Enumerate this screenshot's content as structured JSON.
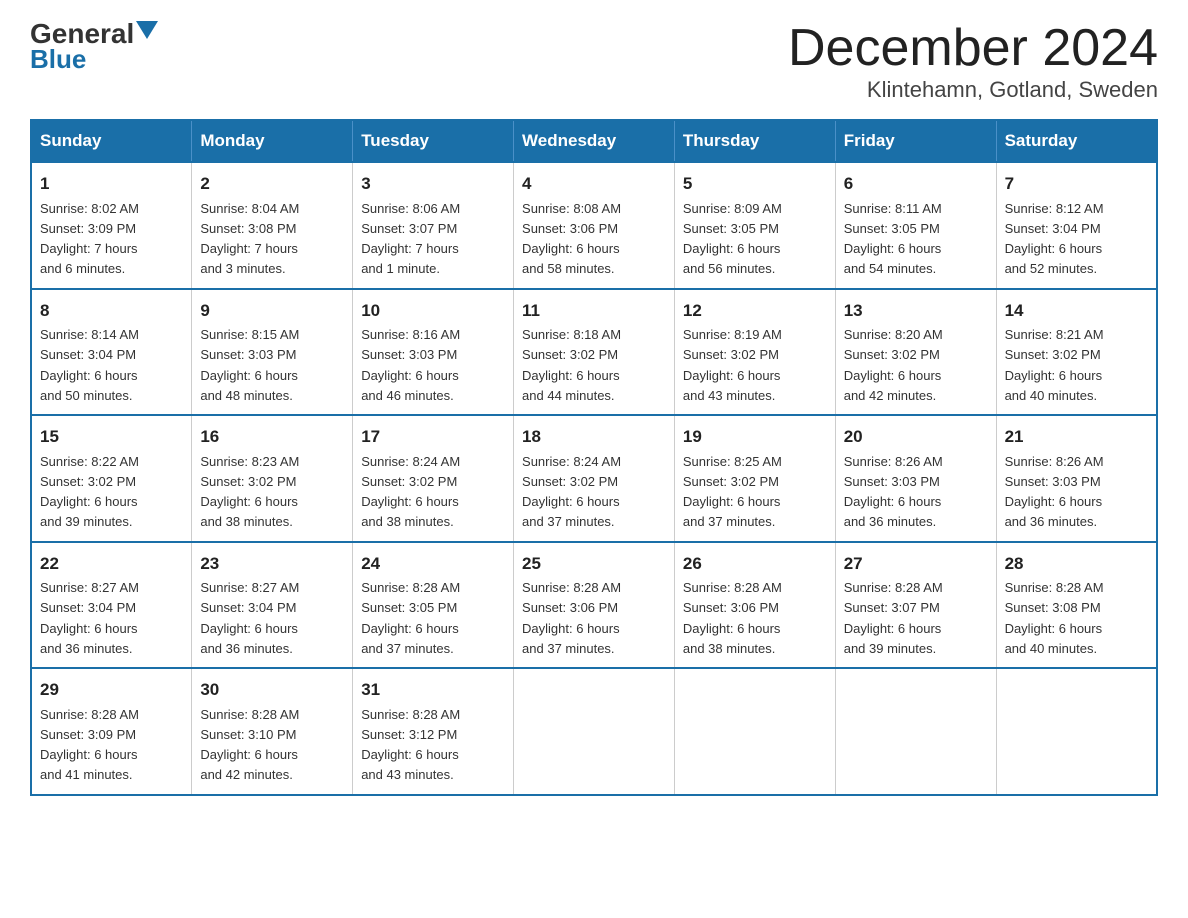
{
  "header": {
    "logo_general": "General",
    "logo_blue": "Blue",
    "title": "December 2024",
    "subtitle": "Klintehamn, Gotland, Sweden"
  },
  "weekdays": [
    "Sunday",
    "Monday",
    "Tuesday",
    "Wednesday",
    "Thursday",
    "Friday",
    "Saturday"
  ],
  "weeks": [
    [
      {
        "day": "1",
        "sunrise": "8:02 AM",
        "sunset": "3:09 PM",
        "daylight": "7 hours and 6 minutes."
      },
      {
        "day": "2",
        "sunrise": "8:04 AM",
        "sunset": "3:08 PM",
        "daylight": "7 hours and 3 minutes."
      },
      {
        "day": "3",
        "sunrise": "8:06 AM",
        "sunset": "3:07 PM",
        "daylight": "7 hours and 1 minute."
      },
      {
        "day": "4",
        "sunrise": "8:08 AM",
        "sunset": "3:06 PM",
        "daylight": "6 hours and 58 minutes."
      },
      {
        "day": "5",
        "sunrise": "8:09 AM",
        "sunset": "3:05 PM",
        "daylight": "6 hours and 56 minutes."
      },
      {
        "day": "6",
        "sunrise": "8:11 AM",
        "sunset": "3:05 PM",
        "daylight": "6 hours and 54 minutes."
      },
      {
        "day": "7",
        "sunrise": "8:12 AM",
        "sunset": "3:04 PM",
        "daylight": "6 hours and 52 minutes."
      }
    ],
    [
      {
        "day": "8",
        "sunrise": "8:14 AM",
        "sunset": "3:04 PM",
        "daylight": "6 hours and 50 minutes."
      },
      {
        "day": "9",
        "sunrise": "8:15 AM",
        "sunset": "3:03 PM",
        "daylight": "6 hours and 48 minutes."
      },
      {
        "day": "10",
        "sunrise": "8:16 AM",
        "sunset": "3:03 PM",
        "daylight": "6 hours and 46 minutes."
      },
      {
        "day": "11",
        "sunrise": "8:18 AM",
        "sunset": "3:02 PM",
        "daylight": "6 hours and 44 minutes."
      },
      {
        "day": "12",
        "sunrise": "8:19 AM",
        "sunset": "3:02 PM",
        "daylight": "6 hours and 43 minutes."
      },
      {
        "day": "13",
        "sunrise": "8:20 AM",
        "sunset": "3:02 PM",
        "daylight": "6 hours and 42 minutes."
      },
      {
        "day": "14",
        "sunrise": "8:21 AM",
        "sunset": "3:02 PM",
        "daylight": "6 hours and 40 minutes."
      }
    ],
    [
      {
        "day": "15",
        "sunrise": "8:22 AM",
        "sunset": "3:02 PM",
        "daylight": "6 hours and 39 minutes."
      },
      {
        "day": "16",
        "sunrise": "8:23 AM",
        "sunset": "3:02 PM",
        "daylight": "6 hours and 38 minutes."
      },
      {
        "day": "17",
        "sunrise": "8:24 AM",
        "sunset": "3:02 PM",
        "daylight": "6 hours and 38 minutes."
      },
      {
        "day": "18",
        "sunrise": "8:24 AM",
        "sunset": "3:02 PM",
        "daylight": "6 hours and 37 minutes."
      },
      {
        "day": "19",
        "sunrise": "8:25 AM",
        "sunset": "3:02 PM",
        "daylight": "6 hours and 37 minutes."
      },
      {
        "day": "20",
        "sunrise": "8:26 AM",
        "sunset": "3:03 PM",
        "daylight": "6 hours and 36 minutes."
      },
      {
        "day": "21",
        "sunrise": "8:26 AM",
        "sunset": "3:03 PM",
        "daylight": "6 hours and 36 minutes."
      }
    ],
    [
      {
        "day": "22",
        "sunrise": "8:27 AM",
        "sunset": "3:04 PM",
        "daylight": "6 hours and 36 minutes."
      },
      {
        "day": "23",
        "sunrise": "8:27 AM",
        "sunset": "3:04 PM",
        "daylight": "6 hours and 36 minutes."
      },
      {
        "day": "24",
        "sunrise": "8:28 AM",
        "sunset": "3:05 PM",
        "daylight": "6 hours and 37 minutes."
      },
      {
        "day": "25",
        "sunrise": "8:28 AM",
        "sunset": "3:06 PM",
        "daylight": "6 hours and 37 minutes."
      },
      {
        "day": "26",
        "sunrise": "8:28 AM",
        "sunset": "3:06 PM",
        "daylight": "6 hours and 38 minutes."
      },
      {
        "day": "27",
        "sunrise": "8:28 AM",
        "sunset": "3:07 PM",
        "daylight": "6 hours and 39 minutes."
      },
      {
        "day": "28",
        "sunrise": "8:28 AM",
        "sunset": "3:08 PM",
        "daylight": "6 hours and 40 minutes."
      }
    ],
    [
      {
        "day": "29",
        "sunrise": "8:28 AM",
        "sunset": "3:09 PM",
        "daylight": "6 hours and 41 minutes."
      },
      {
        "day": "30",
        "sunrise": "8:28 AM",
        "sunset": "3:10 PM",
        "daylight": "6 hours and 42 minutes."
      },
      {
        "day": "31",
        "sunrise": "8:28 AM",
        "sunset": "3:12 PM",
        "daylight": "6 hours and 43 minutes."
      },
      null,
      null,
      null,
      null
    ]
  ],
  "labels": {
    "sunrise": "Sunrise:",
    "sunset": "Sunset:",
    "daylight": "Daylight:"
  }
}
